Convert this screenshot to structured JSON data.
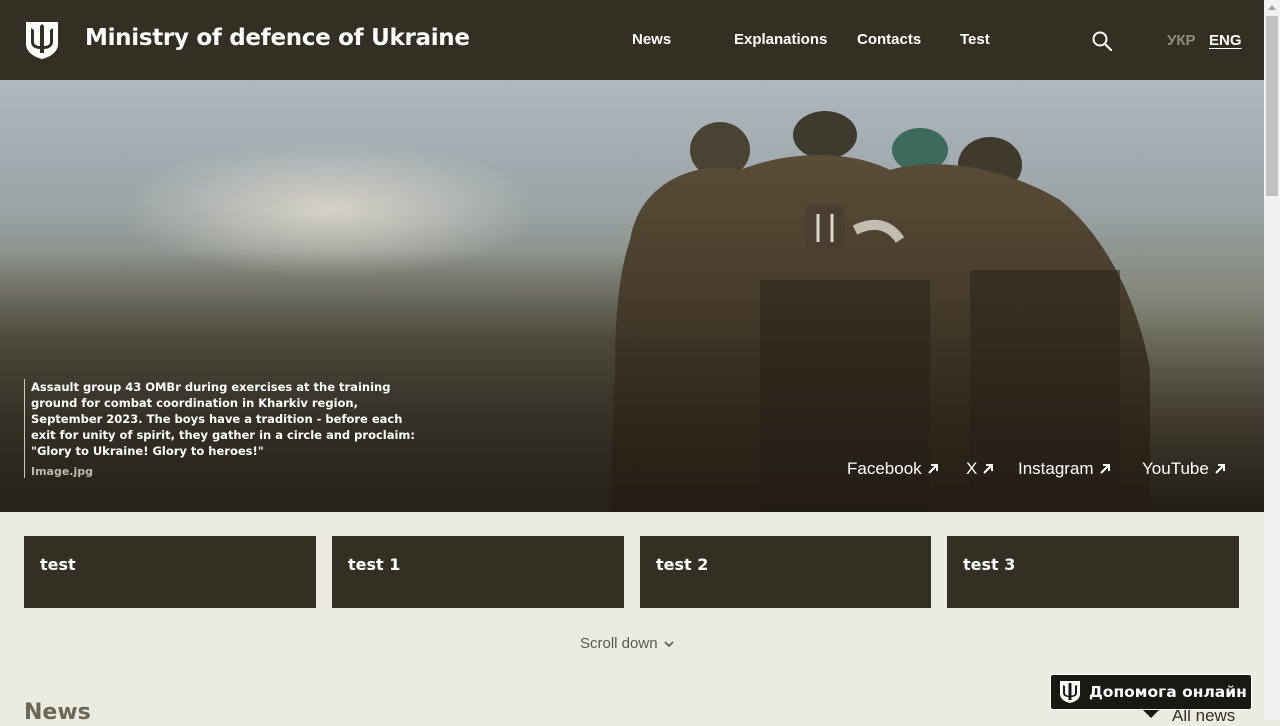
{
  "header": {
    "title": "Ministry of defence of Ukraine",
    "logo_icon": "trident-shield-icon",
    "nav": [
      "News",
      "Explanations",
      "Contacts",
      "Test"
    ],
    "search_icon": "search-icon",
    "languages": {
      "ukr": "УКР",
      "eng": "ENG",
      "active": "ENG"
    }
  },
  "hero": {
    "caption": "Assault group 43 OMBr during exercises at the training ground for combat coordination in Kharkiv region, September 2023. The boys have a tradition - before each exit for unity of spirit, they gather in a circle and proclaim: \"Glory to Ukraine! Glory to heroes!\"",
    "caption_source": "Image.jpg",
    "social": [
      {
        "label": "Facebook",
        "icon": "arrow-up-right-icon"
      },
      {
        "label": "X",
        "icon": "arrow-up-right-icon"
      },
      {
        "label": "Instagram",
        "icon": "arrow-up-right-icon"
      },
      {
        "label": "YouTube",
        "icon": "arrow-up-right-icon"
      }
    ]
  },
  "cards": [
    "test",
    "test 1",
    "test 2",
    "test 3"
  ],
  "scroll_down": {
    "label": "Scroll down",
    "icon": "chevron-down-icon"
  },
  "news": {
    "heading": "News",
    "all_news": "All news"
  },
  "help": {
    "label": "Допомога онлайн",
    "icon": "trident-shield-icon"
  },
  "colors": {
    "header_bg": "#332f22",
    "page_bg": "#ecebe0",
    "card_bg": "#332f22",
    "help_bg": "#1a1813"
  }
}
